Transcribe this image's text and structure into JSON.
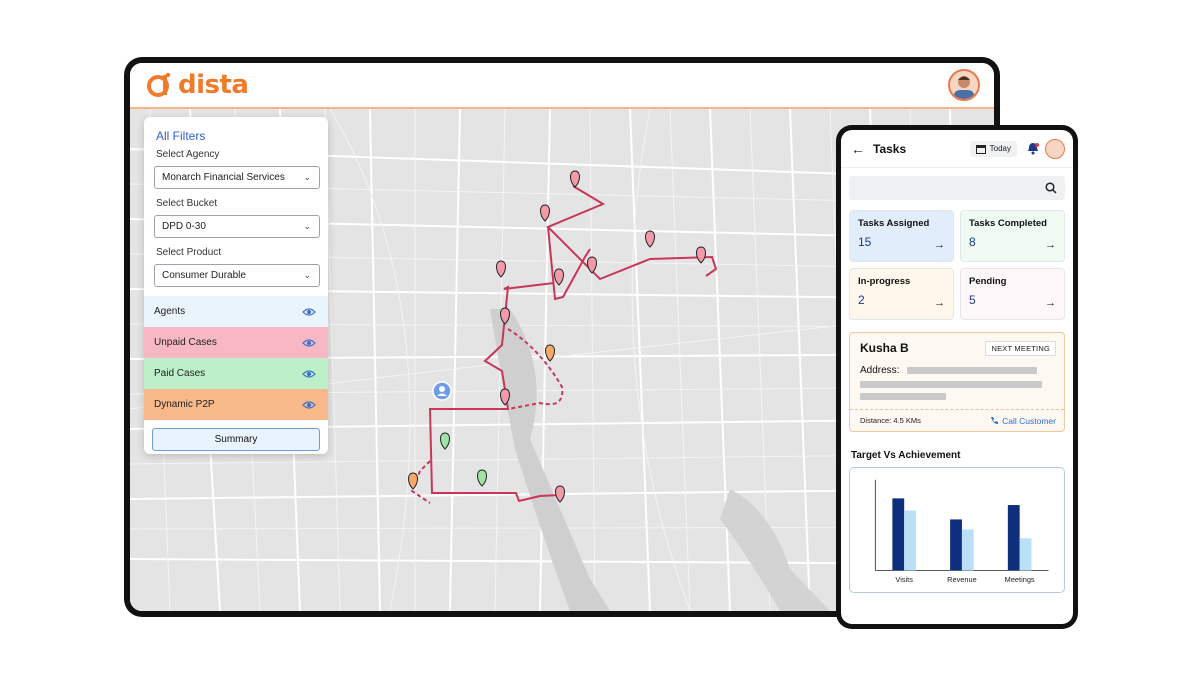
{
  "brand": {
    "name": "dista",
    "color": "#f07b2a"
  },
  "filters": {
    "title": "All Filters",
    "agency_label": "Select Agency",
    "agency_value": "Monarch Financial Services",
    "bucket_label": "Select Bucket",
    "bucket_value": "DPD 0-30",
    "product_label": "Select Product",
    "product_value": "Consumer Durable",
    "layers": [
      {
        "label": "Agents",
        "color": "#eaf4fd",
        "icon": "eye-icon"
      },
      {
        "label": "Unpaid Cases",
        "color": "#f7b8c4",
        "icon": "eye-icon"
      },
      {
        "label": "Paid Cases",
        "color": "#bdf0c9",
        "icon": "eye-icon"
      },
      {
        "label": "Dynamic P2P",
        "color": "#f8b98a",
        "icon": "eye-icon"
      }
    ],
    "summary_label": "Summary"
  },
  "map": {
    "route_color": "#c8365a",
    "pin_colors": {
      "unpaid": "#f29aaa",
      "paid": "#9fe3a8",
      "p2p": "#f5a86a",
      "agent": "#6f9ce8"
    }
  },
  "phone": {
    "title": "Tasks",
    "today_label": "Today",
    "cards": [
      {
        "label": "Tasks Assigned",
        "value": "15",
        "bg": "#e2edfb"
      },
      {
        "label": "Tasks Completed",
        "value": "8",
        "bg": "#eefaf2"
      },
      {
        "label": "In-progress",
        "value": "2",
        "bg": "#fef7ec"
      },
      {
        "label": "Pending",
        "value": "5",
        "bg": "#fdf7f9"
      }
    ],
    "meeting": {
      "name": "Kusha B",
      "badge": "NEXT MEETING",
      "address_label": "Address:",
      "distance": "Distance: 4.5 KMs",
      "call_label": "Call Customer"
    },
    "tva_title": "Target Vs Achievement"
  },
  "chart_data": {
    "type": "bar",
    "categories": [
      "Visits",
      "Revenue",
      "Meetings"
    ],
    "series": [
      {
        "values": [
          65,
          46,
          59
        ],
        "color": "#0e2f7e"
      },
      {
        "values": [
          54,
          37,
          29
        ],
        "color": "#b9e0f7"
      }
    ],
    "ylim": [
      0,
      80
    ],
    "title": "",
    "xlabel": "",
    "ylabel": "",
    "grid": false
  }
}
